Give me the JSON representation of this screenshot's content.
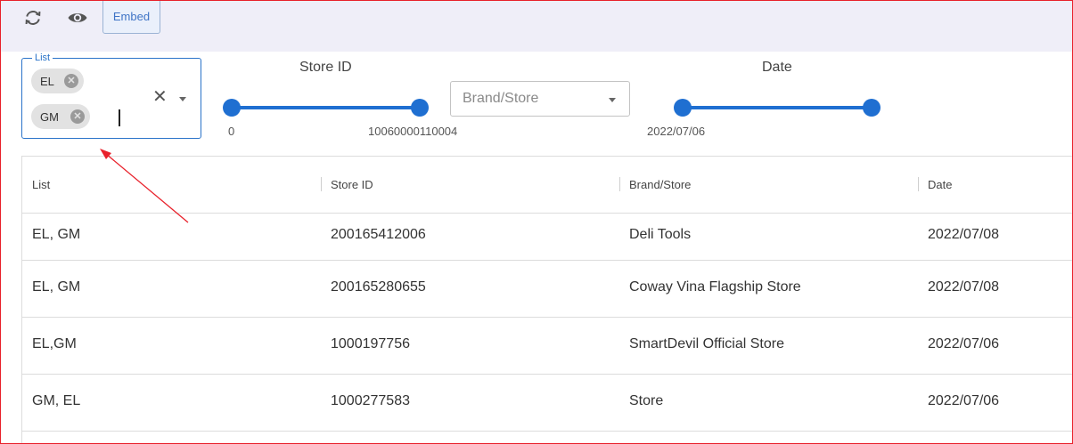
{
  "toolbar": {
    "refresh_icon": "refresh-icon",
    "preview_icon": "eye-icon",
    "embed_label": "Embed"
  },
  "filters": {
    "list": {
      "legend": "List",
      "chips": [
        "EL",
        "GM"
      ],
      "chip_remove_icon": "close-circle-icon",
      "clear_icon": "close-icon",
      "dropdown_icon": "chevron-down-icon"
    },
    "store_id": {
      "title": "Store ID",
      "min_label": "0",
      "max_label": "10060000110004"
    },
    "brand_store": {
      "placeholder": "Brand/Store",
      "dropdown_icon": "chevron-down-icon"
    },
    "date": {
      "title": "Date",
      "min_label": "2022/07/06"
    }
  },
  "table": {
    "columns": [
      "List",
      "Store ID",
      "Brand/Store",
      "Date"
    ],
    "rows": [
      [
        "EL, GM",
        "200165412006",
        "Deli Tools",
        "2022/07/08"
      ],
      [
        "EL, GM",
        "200165280655",
        "Coway Vina Flagship Store",
        "2022/07/08"
      ],
      [
        "EL,GM",
        "1000197756",
        "SmartDevil Official Store",
        "2022/07/06"
      ],
      [
        "GM, EL",
        "1000277583",
        "Store",
        "2022/07/06"
      ]
    ]
  },
  "annotation": {
    "arrow_color": "#e8212b"
  },
  "colors": {
    "accent": "#1f6fd1",
    "frame_border": "#e8212b",
    "topbar_bg": "#efeef8"
  }
}
